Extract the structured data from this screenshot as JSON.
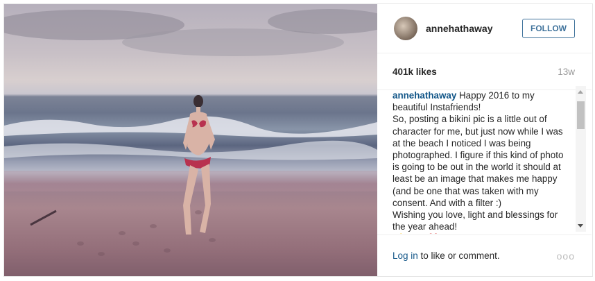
{
  "post": {
    "username": "annehathaway",
    "follow_label": "FOLLOW",
    "likes": "401k likes",
    "age": "13w",
    "caption_user": "annehathaway",
    "caption_text": " Happy 2016 to my beautiful Instafriends!\nSo, posting a bikini pic is a little out of character for me, but just now while I was at the beach I noticed I was being photographed. I figure if this kind of photo is going to be out in the world it should at least be an image that makes me happy (and be one that was taken with my consent. And with a filter :)\nWishing you love, light and blessings for the year ahead!\n⚡️Annie❤️",
    "login_label": "Log in",
    "comment_suffix": " to like or comment.",
    "more_glyph": "ooo"
  },
  "icons": {
    "avatar": "profile-photo",
    "more": "more-options-icon"
  },
  "colors": {
    "follow_blue": "#3f729b",
    "link_blue": "#125688"
  }
}
